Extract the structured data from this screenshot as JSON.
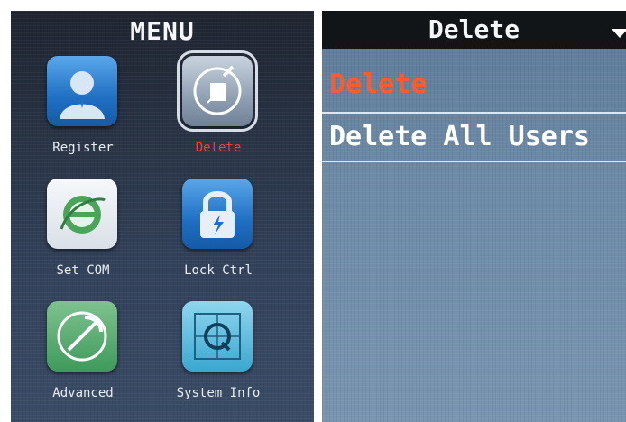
{
  "left": {
    "title": "MENU",
    "items": [
      {
        "label": "Register",
        "icon": "register-icon"
      },
      {
        "label": "Delete",
        "icon": "delete-icon"
      },
      {
        "label": "Set COM",
        "icon": "set-com-icon"
      },
      {
        "label": "Lock Ctrl",
        "icon": "lock-icon"
      },
      {
        "label": "Advanced",
        "icon": "advanced-icon"
      },
      {
        "label": "System Info",
        "icon": "system-info-icon"
      }
    ]
  },
  "right": {
    "title": "Delete",
    "items": [
      {
        "label": "Delete",
        "selected": true
      },
      {
        "label": "Delete All Users",
        "selected": false
      }
    ]
  },
  "colors": {
    "selected_text": "#ff5a2e",
    "normal_text": "#ffffff",
    "active_label": "#ff3b2f"
  }
}
